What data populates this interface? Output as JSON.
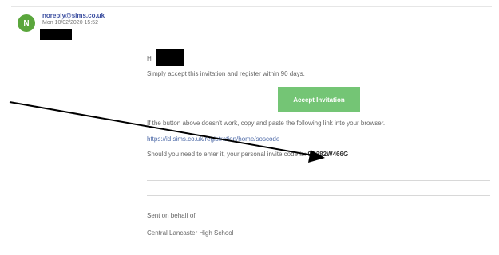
{
  "sender": {
    "initial": "N",
    "email": "noreply@sims.co.uk",
    "date": "Mon 10/02/2020 15:52"
  },
  "body": {
    "greeting": "Hi",
    "accept_line": "Simply accept this invitation and register within 90 days.",
    "button_label": "Accept Invitation",
    "fallback_line": "If the button above doesn't work, copy and paste the following link into your browser.",
    "link": "https://id.sims.co.uk/registration/home/soscode",
    "invite_prefix": "Should you need to enter it, your personal invite code is:",
    "invite_code": "9K382W466G",
    "sent_on_behalf": "Sent on behalf of,",
    "school": "Central Lancaster High School"
  },
  "colors": {
    "avatar": "#5aa63c",
    "button": "#74c575",
    "link": "#4f6ba8"
  }
}
